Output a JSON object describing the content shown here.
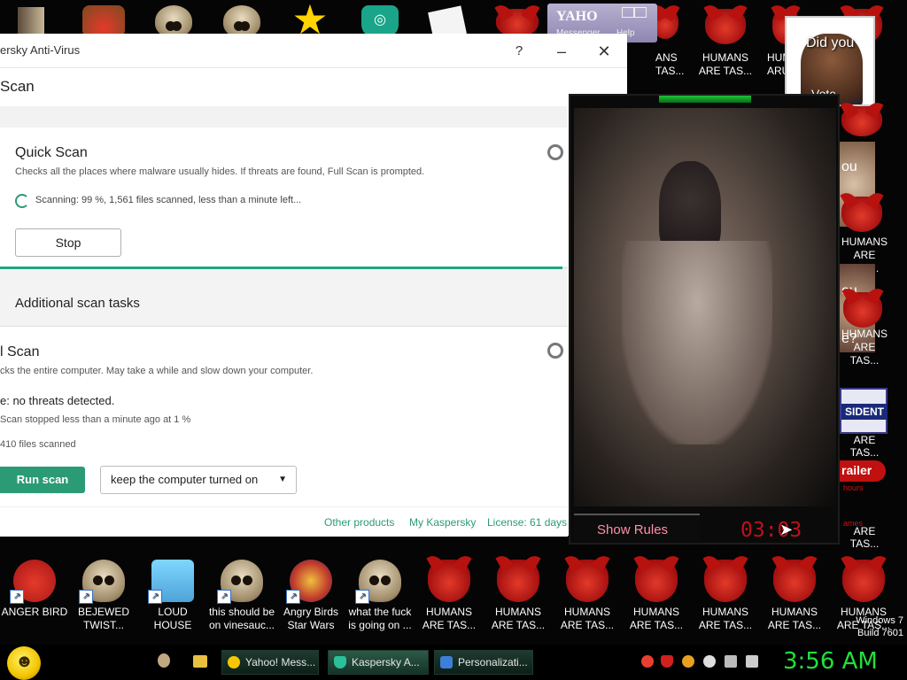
{
  "desktop": {
    "bottom_icons": [
      {
        "label": "ANGER BIRD",
        "kind": "bird"
      },
      {
        "label": "BEJEWED\nTWIST...",
        "kind": "skull"
      },
      {
        "label": "LOUD HOUSE",
        "kind": "house"
      },
      {
        "label": "this should be\non vinesauc...",
        "kind": "skull"
      },
      {
        "label": "Angry Birds\nStar Wars",
        "kind": "sw"
      },
      {
        "label": "what the fuck\nis going on ...",
        "kind": "skull"
      },
      {
        "label": "HUMANS\nARE TAS...",
        "kind": "devil"
      },
      {
        "label": "HUMANS\nARE TAS...",
        "kind": "devil"
      },
      {
        "label": "HUMANS\nARE TAS...",
        "kind": "devil"
      },
      {
        "label": "HUMANS\nARE TAS...",
        "kind": "devil"
      },
      {
        "label": "HUMANS\nARE TAS...",
        "kind": "devil"
      },
      {
        "label": "HUMANS\nARE TAS...",
        "kind": "devil"
      },
      {
        "label": "HUMANS\nARE TAS...",
        "kind": "devil"
      }
    ],
    "top_right_labels": [
      "ANS\nTAS...",
      "HUMANS\nARE TAS...",
      "HUMANS\nARU..."
    ],
    "right_column_labels": [
      "HUMANS\nARE TAS...",
      "HUMANS\nARE TAS...",
      "ARE TAS...",
      "ARE TAS..."
    ],
    "obama_text": "Did you",
    "obama_text2": "Vote",
    "partial_side_texts": [
      "ou",
      "e?",
      "ou",
      "e?"
    ],
    "sident_badge": "SIDENT",
    "trailer_text": "railer",
    "hours_text": "hours",
    "games_text": "ames",
    "watermark": "Windows 7\nBuild 7601",
    "yahoo_logo": "YAHO",
    "yahoo_menu": [
      "Messenger",
      "Help"
    ]
  },
  "kaspersky": {
    "title": "ersky Anti-Virus",
    "header": "Scan",
    "quick_scan": {
      "title": "Quick Scan",
      "desc": "Checks all the places where malware usually hides. If threats are found, Full Scan is prompted.",
      "status": "Scanning: 99 %, 1,561 files scanned, less than a minute left...",
      "progress": 0.99,
      "stop_label": "Stop"
    },
    "additional_title": "Additional scan tasks",
    "full_scan": {
      "title": "l Scan",
      "desc": "cks the entire computer. May take a while and slow down your computer.",
      "result": "e: no threats detected.",
      "stopped": "Scan stopped less than a minute ago at 1 %",
      "files": "410 files scanned",
      "run_label": "Run scan",
      "select_value": "keep the computer turned on"
    },
    "footer": {
      "other_products": "Other products",
      "my_kaspersky": "My Kaspersky",
      "license": "License: 61 days r"
    }
  },
  "horror_game": {
    "show_rules": "Show Rules",
    "timer": "03:03"
  },
  "taskbar": {
    "tasks": [
      {
        "label": "Yahoo! Mess..."
      },
      {
        "label": "Kaspersky A..."
      },
      {
        "label": "Personalizati..."
      }
    ],
    "clock": "3:56 AM"
  },
  "colors": {
    "kaspersky_green": "#2b9b76",
    "taskbar_clock": "#22e03a",
    "timer_red": "#c0101a"
  }
}
